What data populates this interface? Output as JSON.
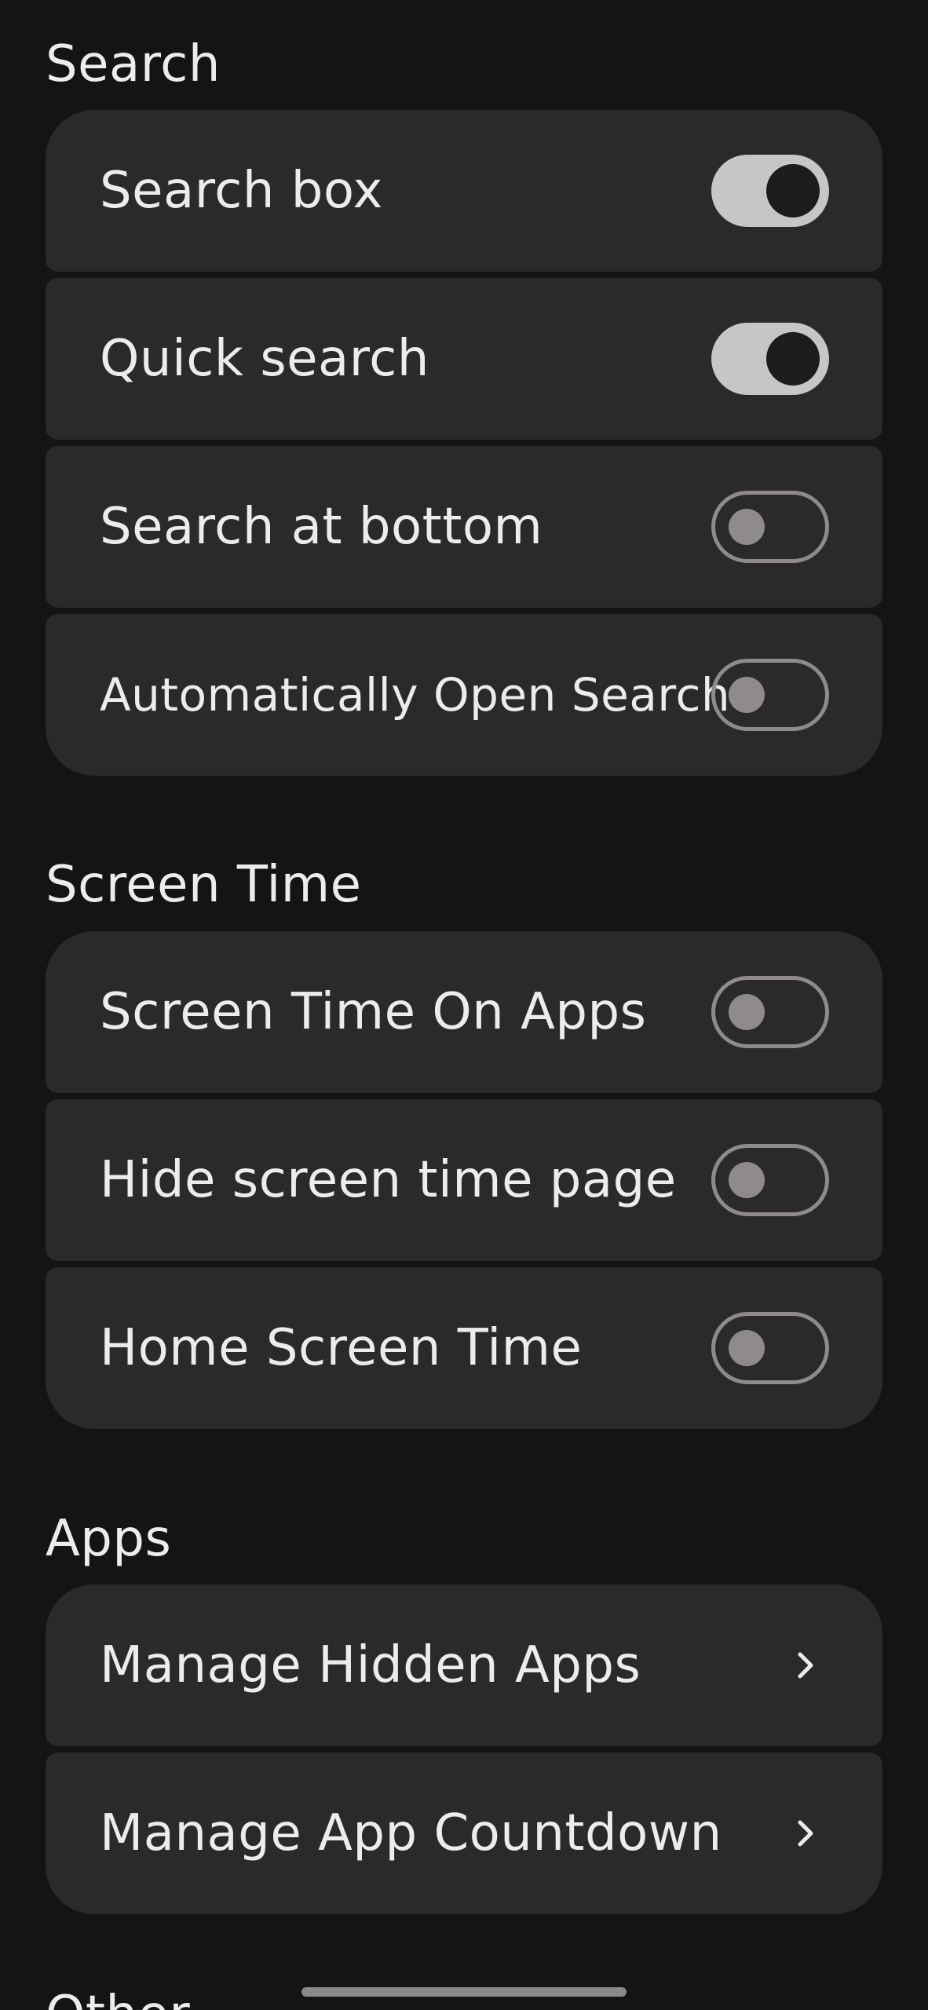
{
  "sections": {
    "search": {
      "title": "Search",
      "items": [
        {
          "label": "Search box",
          "toggle": "on"
        },
        {
          "label": "Quick search",
          "toggle": "on"
        },
        {
          "label": "Search at bottom",
          "toggle": "off"
        },
        {
          "label": "Automatically Open Search",
          "toggle": "off"
        }
      ]
    },
    "screen_time": {
      "title": "Screen Time",
      "items": [
        {
          "label": "Screen Time On Apps",
          "toggle": "off"
        },
        {
          "label": "Hide screen time page",
          "toggle": "off"
        },
        {
          "label": "Home Screen Time",
          "toggle": "off"
        }
      ]
    },
    "apps": {
      "title": "Apps",
      "items": [
        {
          "label": "Manage Hidden Apps",
          "icon": "chevron-right-icon"
        },
        {
          "label": "Manage App Countdown",
          "icon": "chevron-right-icon"
        }
      ]
    },
    "other": {
      "title": "Other"
    }
  },
  "colors": {
    "background": "#141414",
    "card": "#2a2a2a",
    "text": "#ececec",
    "toggle_on_track": "#c6c6c6",
    "toggle_off_outline": "#8f8a8b"
  }
}
